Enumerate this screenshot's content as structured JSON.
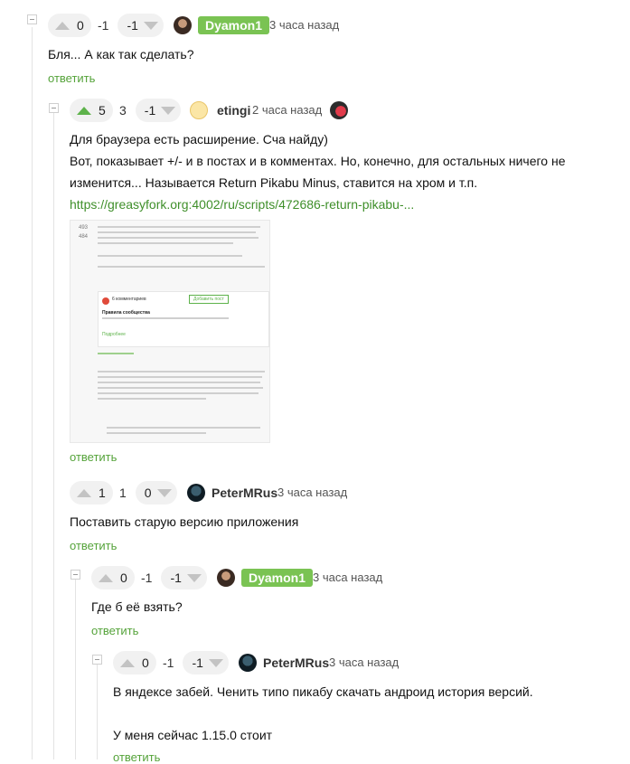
{
  "comments": [
    {
      "rating": {
        "plus": "0",
        "minus": "-1",
        "total": "-1"
      },
      "author": "Dyamon1",
      "time": "3 часа назад",
      "lines": [
        "Бля... А как так сделать?"
      ],
      "reply": "ответить"
    },
    {
      "rating": {
        "plus": "5",
        "minus": "3",
        "total": "-1"
      },
      "author": "etingi",
      "time": "2 часа назад",
      "lines": [
        "Для браузера есть расширение. Сча найду)",
        "Вот, показывает +/- и в постах и в комментах. Но, конечно, для остальных ничего не",
        "изменится... Называется Return Pikabu Minus, ставится на хром и т.п."
      ],
      "link": "https://greasyfork.org:4002/ru/scripts/472686-return-pikabu-...",
      "reply": "ответить"
    },
    {
      "rating": {
        "plus": "1",
        "minus": "1",
        "total": "0"
      },
      "author": "PeterMRus",
      "time": "3 часа назад",
      "lines": [
        "Поставить старую версию приложения"
      ],
      "reply": "ответить"
    },
    {
      "rating": {
        "plus": "0",
        "minus": "-1",
        "total": "-1"
      },
      "author": "Dyamon1",
      "time": "3 часа назад",
      "lines": [
        "Где б её взять?"
      ],
      "reply": "ответить"
    },
    {
      "rating": {
        "plus": "0",
        "minus": "-1",
        "total": "-1"
      },
      "author": "PeterMRus",
      "time": "3 часа назад",
      "lines": [
        "В яндексе забей. Ченить типо пикабу скачать андроид история версий.",
        "У меня сейчас 1.15.0 стоит"
      ],
      "reply": "ответить"
    }
  ],
  "screenshot": {
    "rating_top": "493",
    "rating_bottom": "484",
    "add_post_button": "Добавить пост",
    "comment_count": "6 комментариев",
    "rules_title": "Правила сообщества",
    "subscribe": "Подробнее"
  },
  "colors": {
    "accent_green": "#5db24a",
    "badge_green": "#7ac353",
    "link_green": "#3f8f2a"
  }
}
